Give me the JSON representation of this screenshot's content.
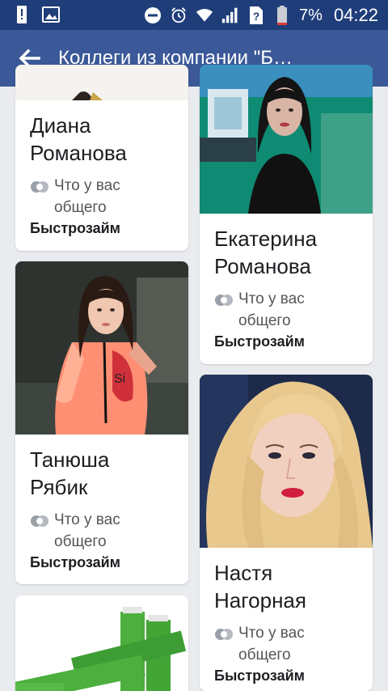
{
  "status_bar": {
    "battery": "7%",
    "time": "04:22",
    "icons": [
      "alert-icon",
      "image-icon",
      "dnd-icon",
      "alarm-icon",
      "wifi-icon",
      "signal-icon",
      "no-sim-icon",
      "battery-icon"
    ]
  },
  "header": {
    "title": "Коллеги из компании \"Б…",
    "back_icon": "arrow-left-icon"
  },
  "colors": {
    "status_bar": "#1f3d79",
    "app_bar": "#3b5998",
    "background": "#e9ebee",
    "card": "#ffffff"
  },
  "cards": [
    {
      "name_line1": "Диана",
      "name_line2": "Романова",
      "common_line1": "Что у вас",
      "common_line2": "общего",
      "company": "Быстрозайм"
    },
    {
      "name_line1": "Екатерина",
      "name_line2": "Романова",
      "common_line1": "Что у вас",
      "common_line2": "общего",
      "company": "Быстрозайм"
    },
    {
      "name_line1": "Танюша",
      "name_line2": "Рябик",
      "common_line1": "Что у вас",
      "common_line2": "общего",
      "company": "Быстрозайм"
    },
    {
      "name_line1": "Настя",
      "name_line2": "Нагорная",
      "common_line1": "Что у вас",
      "common_line2": "общего",
      "company": "Быстрозайм"
    }
  ]
}
